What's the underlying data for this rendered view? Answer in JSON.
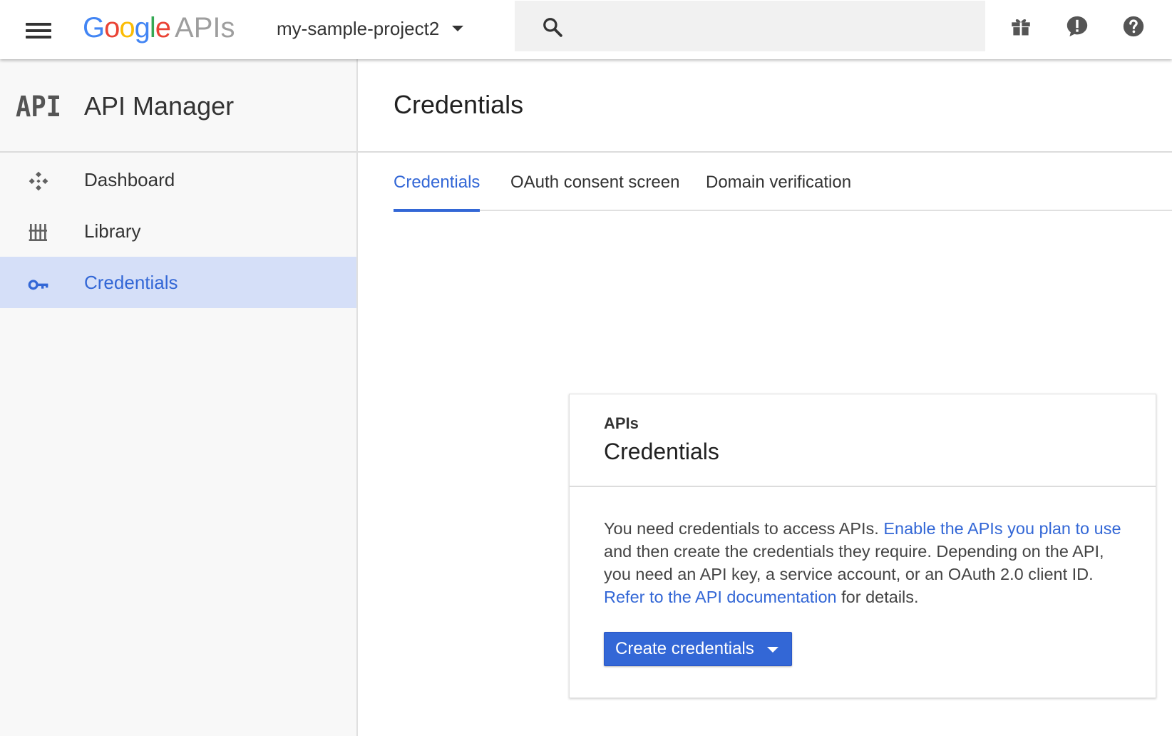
{
  "topbar": {
    "logo": {
      "letters": [
        "G",
        "o",
        "o",
        "g",
        "l",
        "e"
      ],
      "suffix": "APIs"
    },
    "project": "my-sample-project2",
    "search_placeholder": "",
    "icons": [
      "menu-icon",
      "search-icon",
      "gift-icon",
      "feedback-icon",
      "help-icon"
    ]
  },
  "sidebar": {
    "logo_text": "API",
    "title": "API Manager",
    "items": [
      {
        "label": "Dashboard",
        "icon": "dashboard-icon",
        "active": false
      },
      {
        "label": "Library",
        "icon": "library-icon",
        "active": false
      },
      {
        "label": "Credentials",
        "icon": "key-icon",
        "active": true
      }
    ]
  },
  "main": {
    "title": "Credentials",
    "tabs": [
      {
        "label": "Credentials",
        "active": true
      },
      {
        "label": "OAuth consent screen",
        "active": false
      },
      {
        "label": "Domain verification",
        "active": false
      }
    ],
    "card": {
      "overline": "APIs",
      "title": "Credentials",
      "body_pre": "You need credentials to access APIs. ",
      "link1": "Enable the APIs you plan to use",
      "body_mid": " and then create the credentials they require. Depending on the API, you need an API key, a service account, or an OAuth 2.0 client ID. ",
      "link2": "Refer to the API documentation",
      "body_post": " for details.",
      "button": "Create credentials"
    }
  },
  "colors": {
    "accent": "#3367d6",
    "active_nav_bg": "#d5dff8",
    "google_blue": "#4285f4",
    "google_red": "#ea4335",
    "google_yellow": "#fbbc05",
    "google_green": "#34a853"
  }
}
